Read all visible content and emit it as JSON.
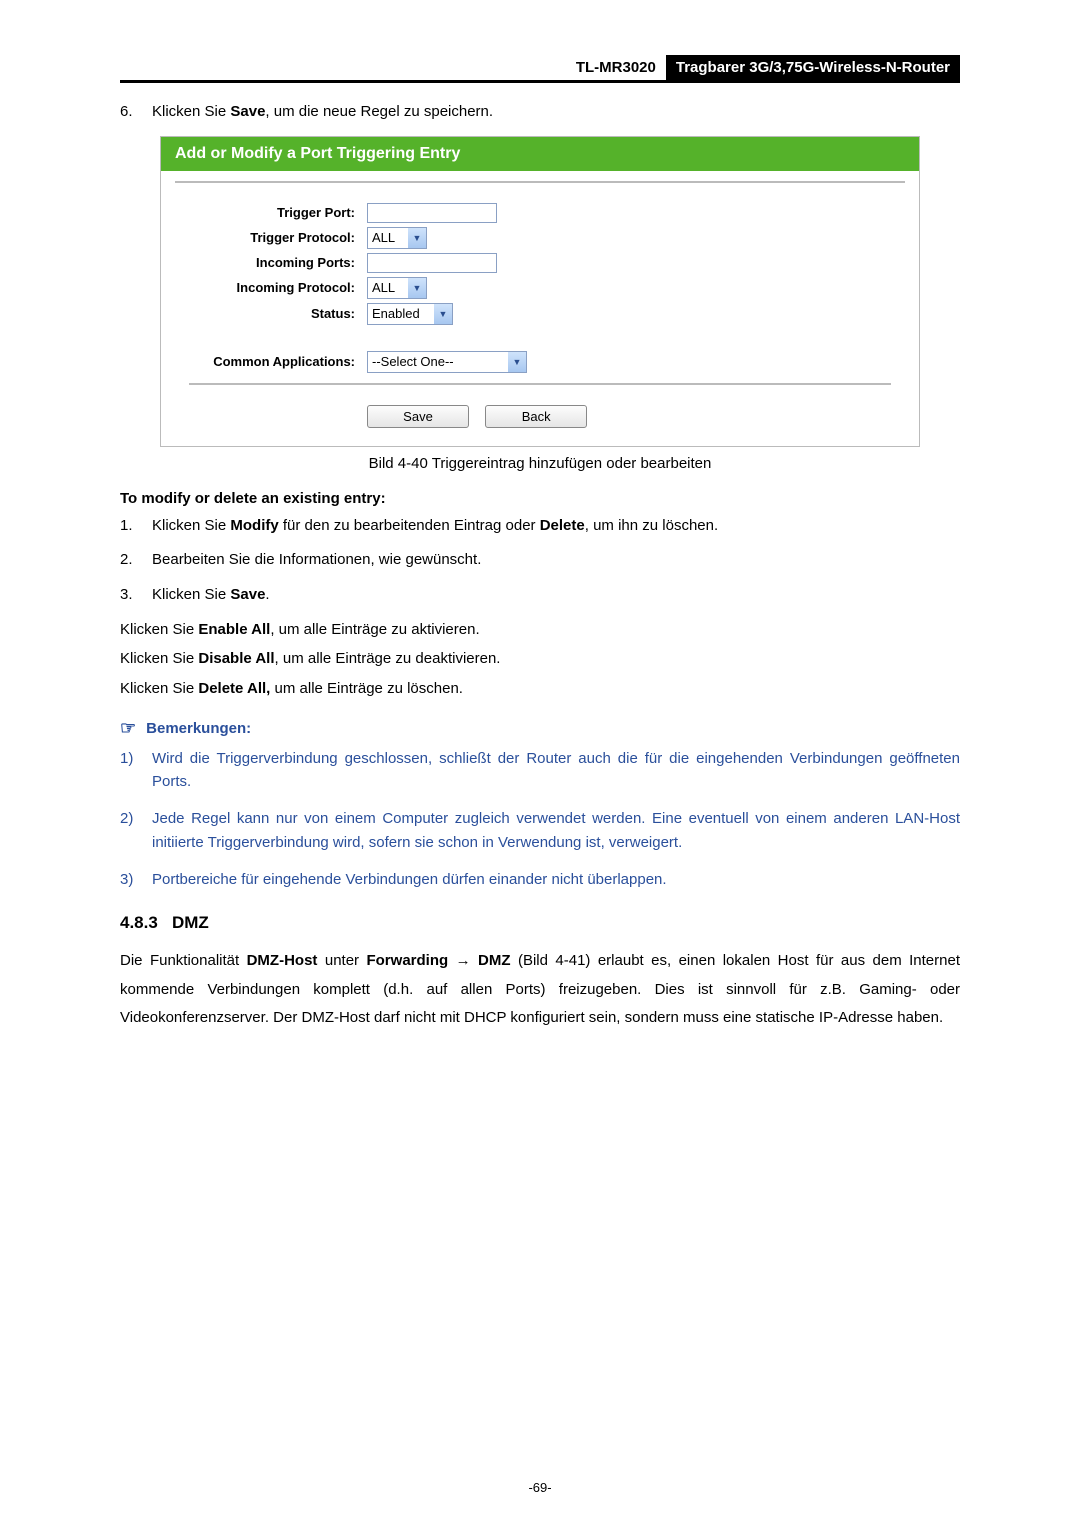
{
  "header": {
    "model": "TL-MR3020",
    "tagline": "Tragbarer 3G/3,75G-Wireless-N-Router"
  },
  "intro_step": {
    "num": "6.",
    "pre": "Klicken Sie ",
    "bold": "Save",
    "post": ", um die neue Regel zu speichern."
  },
  "figure": {
    "title": "Add or Modify a Port Triggering Entry",
    "rows": {
      "trigger_port": {
        "label": "Trigger Port:",
        "value": ""
      },
      "trigger_protocol": {
        "label": "Trigger Protocol:",
        "value": "ALL"
      },
      "incoming_ports": {
        "label": "Incoming Ports:",
        "value": ""
      },
      "incoming_protocol": {
        "label": "Incoming Protocol:",
        "value": "ALL"
      },
      "status": {
        "label": "Status:",
        "value": "Enabled"
      },
      "common_apps": {
        "label": "Common Applications:",
        "value": "--Select One--"
      }
    },
    "buttons": {
      "save": "Save",
      "back": "Back"
    },
    "caption": "Bild 4-40 Triggereintrag hinzufügen oder bearbeiten"
  },
  "modify_heading": "To modify or delete an existing entry:",
  "modify_steps": [
    {
      "num": "1.",
      "parts": [
        "Klicken Sie ",
        "Modify",
        " für den zu bearbeitenden Eintrag oder ",
        "Delete",
        ", um ihn zu löschen."
      ]
    },
    {
      "num": "2.",
      "parts": [
        "Bearbeiten Sie die Informationen, wie gewünscht."
      ]
    },
    {
      "num": "3.",
      "parts": [
        "Klicken Sie ",
        "Save",
        "."
      ]
    }
  ],
  "bulk_lines": [
    {
      "pre": "Klicken Sie ",
      "bold": "Enable All",
      "post": ", um alle Einträge zu aktivieren."
    },
    {
      "pre": "Klicken Sie ",
      "bold": "Disable All",
      "post": ", um alle Einträge zu deaktivieren."
    },
    {
      "pre": "Klicken Sie ",
      "bold": "Delete All,",
      "post": " um alle Einträge zu löschen."
    }
  ],
  "notes": {
    "heading": "Bemerkungen:",
    "items": [
      {
        "num": "1)",
        "text": "Wird die Triggerverbindung geschlossen, schließt der Router auch die für die eingehenden Verbindungen geöffneten Ports."
      },
      {
        "num": "2)",
        "text": "Jede Regel kann nur von einem Computer zugleich verwendet werden. Eine eventuell von einem anderen LAN-Host initiierte Triggerverbindung wird, sofern sie schon in Verwendung ist, verweigert."
      },
      {
        "num": "3)",
        "text": "Portbereiche für eingehende Verbindungen dürfen einander nicht überlappen."
      }
    ]
  },
  "section": {
    "num": "4.8.3",
    "title": "DMZ",
    "para_parts": [
      "Die Funktionalität ",
      "DMZ-Host",
      " unter ",
      "Forwarding → DMZ",
      " (Bild 4-41) erlaubt es, einen lokalen Host für aus dem Internet kommende Verbindungen komplett (d.h. auf allen Ports) freizugeben. Dies ist sinnvoll für z.B. Gaming- oder Videokonferenzserver. Der DMZ-Host darf nicht mit DHCP konfiguriert sein, sondern muss eine statische IP-Adresse haben."
    ]
  },
  "page_number": "-69-"
}
